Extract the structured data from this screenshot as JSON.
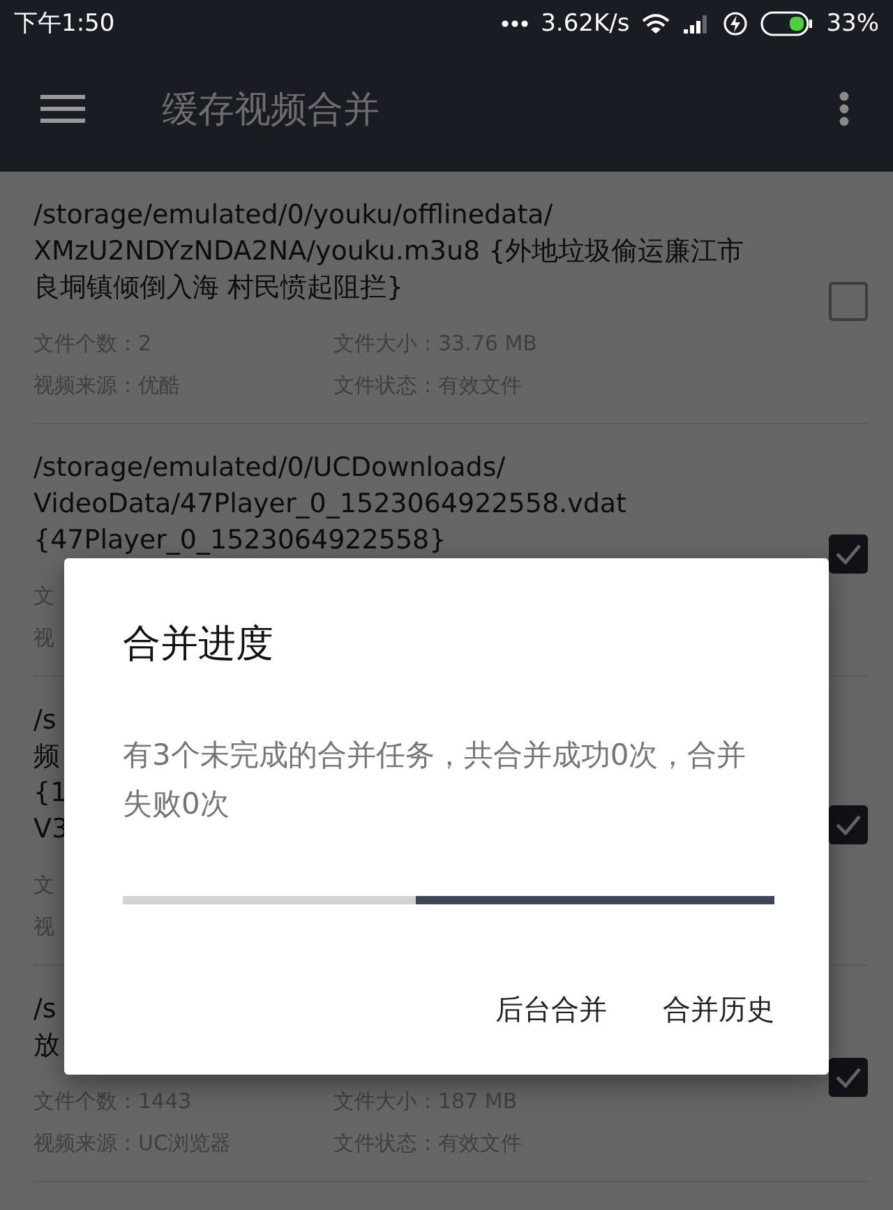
{
  "status_bar": {
    "time": "下午1:50",
    "speed": "3.62K/s",
    "battery": "33%"
  },
  "toolbar": {
    "title": "缓存视频合并"
  },
  "items": [
    {
      "path_lines": [
        "/storage/emulated/0/youku/offlinedata/",
        "XMzU2NDYzNDA2NA/youku.m3u8  {外地垃圾偷运廉江市",
        "良垌镇倾倒入海 村民愤起阻拦}"
      ],
      "meta": [
        {
          "left": "文件个数：2",
          "right": "文件大小：33.76 MB"
        },
        {
          "left": "视频来源：优酷",
          "right": "文件状态：有效文件"
        }
      ],
      "checked": false
    },
    {
      "path_lines": [
        "/storage/emulated/0/UCDownloads/",
        "VideoData/47Player_0_1523064922558.vdat",
        "{47Player_0_1523064922558}"
      ],
      "meta": [
        {
          "left": "文"
        },
        {
          "left": "视"
        }
      ],
      "checked": true
    },
    {
      "path_lines": [
        "/s",
        "频",
        "{1",
        "V3"
      ],
      "meta": [
        {
          "left": "文"
        },
        {
          "left": "视"
        }
      ],
      "checked": true
    },
    {
      "path_lines": [
        "/s",
        "放"
      ],
      "meta": [
        {
          "left": "文件个数：1443",
          "right": "文件大小：187 MB"
        },
        {
          "left": "视频来源：UC浏览器",
          "right": "文件状态：有效文件"
        }
      ],
      "checked": true
    }
  ],
  "dialog": {
    "title": "合并进度",
    "message": "有3个未完成的合并任务，共合并成功0次，合并失败0次",
    "progress": {
      "level": 0.55
    },
    "buttons": [
      "后台合并",
      "合并历史"
    ]
  }
}
